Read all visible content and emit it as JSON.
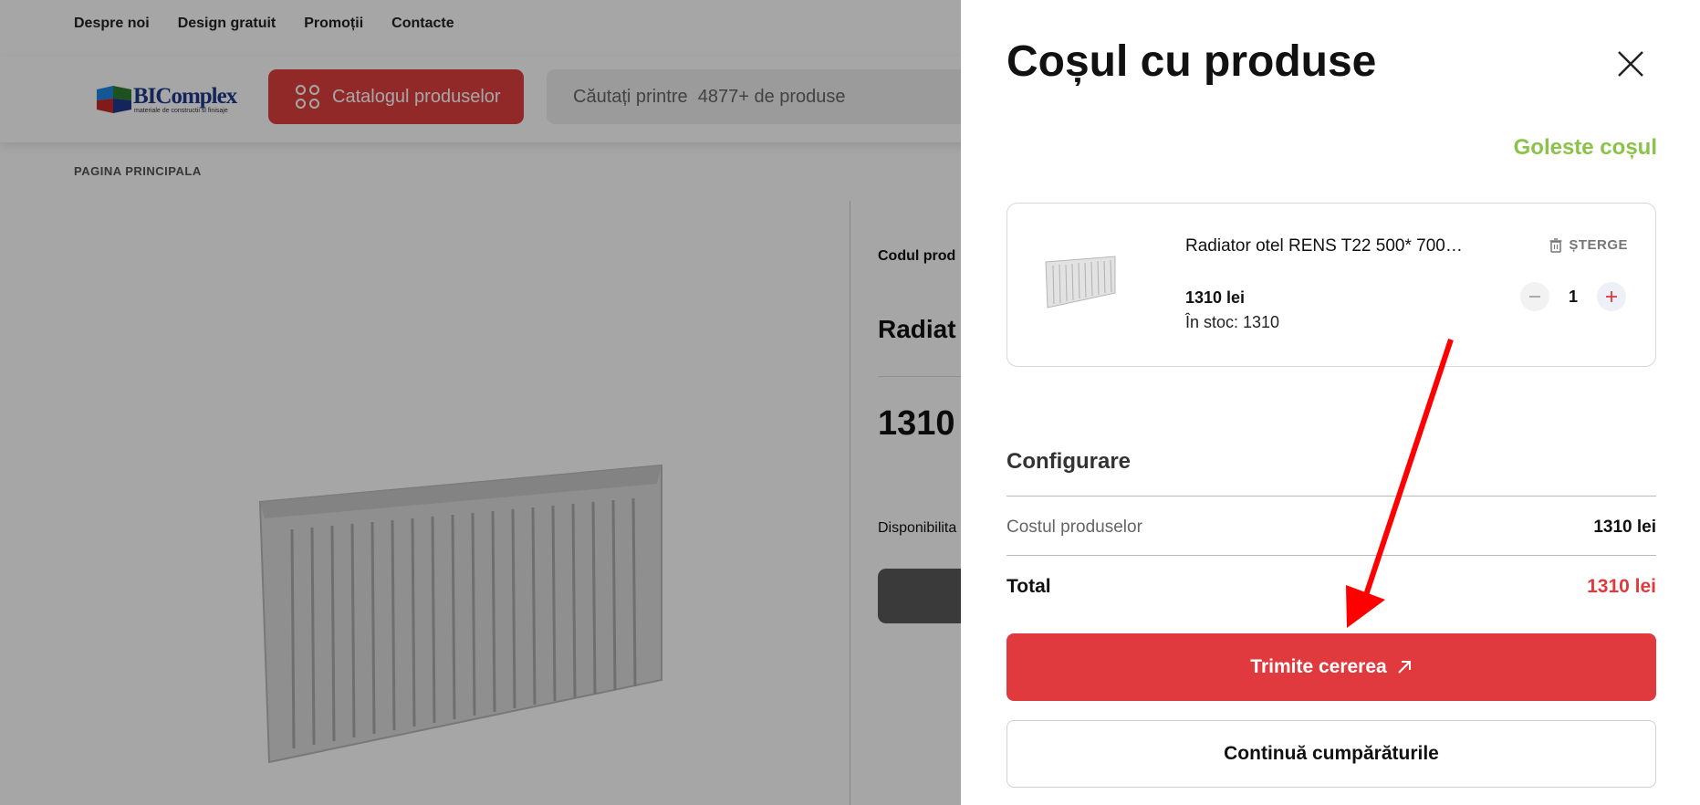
{
  "topnav": {
    "items": [
      "Despre noi",
      "Design gratuit",
      "Promoții",
      "Contacte"
    ]
  },
  "header": {
    "logo_text": "BIComplex",
    "logo_tagline": "materiale de constructii si finisaje",
    "catalog_label": "Catalogul produselor",
    "catalog_icon": "grid-icon",
    "search_placeholder": "Căutați printre  4877+ de produse"
  },
  "breadcrumb": "PAGINA PRINCIPALA",
  "product": {
    "code_label": "Codul prod",
    "title": "Radiat",
    "price": "1310",
    "availability": "Disponibilita"
  },
  "cart": {
    "title": "Coșul cu produse",
    "close_icon": "close-icon",
    "clear_label": "Goleste coșul",
    "accent_color": "#8bc34a",
    "items": [
      {
        "name": "Radiator otel RENS T22 500* 700…",
        "price": "1310 lei",
        "stock": "În stoc: 1310",
        "quantity": "1",
        "delete_label": "ȘTERGE"
      }
    ],
    "config_title": "Configurare",
    "products_cost_label": "Costul produselor",
    "products_cost_value": "1310 lei",
    "total_label": "Total",
    "total_value": "1310 lei",
    "total_color": "#e03a3e",
    "send_label": "Trimite cererea",
    "continue_label": "Continuă cumpărăturile"
  },
  "annotation": {
    "arrow_color": "#ff0000"
  }
}
